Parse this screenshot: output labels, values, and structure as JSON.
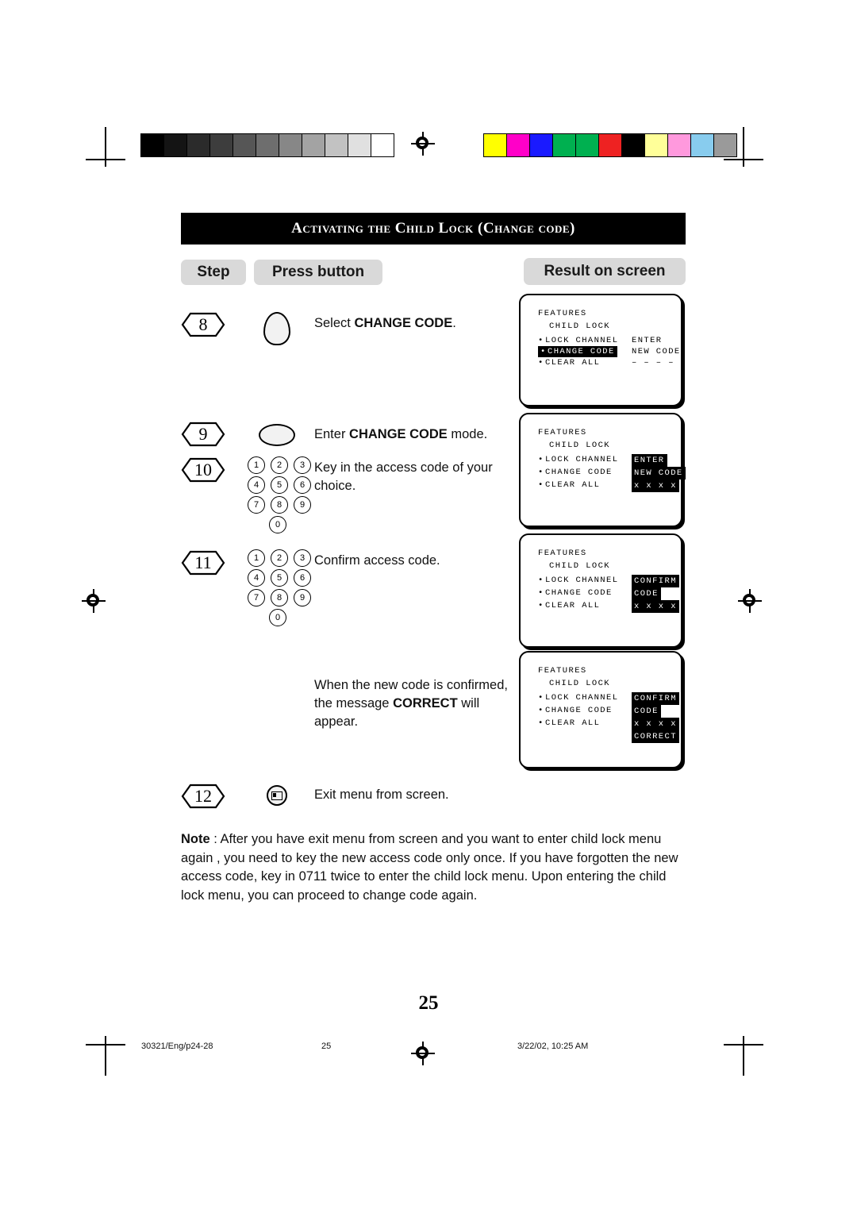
{
  "document": {
    "title": "Activating the Child Lock (Change code)",
    "page_number": "25",
    "footer": {
      "left": "30321/Eng/p24-28",
      "center": "25",
      "right": "3/22/02, 10:25 AM"
    }
  },
  "columns": {
    "step": "Step",
    "press_button": "Press button",
    "result": "Result on screen"
  },
  "steps": [
    {
      "number": "8",
      "control": "oval-button",
      "instruction_html": "Select <b>CHANGE CODE</b>.",
      "screen": {
        "header": "FEATURES",
        "sub": "CHILD LOCK",
        "rows": [
          {
            "label": "LOCK CHANNEL",
            "value": "ENTER",
            "label_inverted": false,
            "value_inverted": false
          },
          {
            "label": "CHANGE CODE",
            "value": "NEW CODE",
            "label_inverted": true,
            "value_inverted": false
          },
          {
            "label": "CLEAR ALL",
            "value": "– – – –",
            "label_inverted": false,
            "value_inverted": false
          }
        ]
      }
    },
    {
      "number": "9",
      "control": "flat-oval-button",
      "instruction_html": "Enter <b>CHANGE CODE</b> mode.",
      "screen": {
        "header": "FEATURES",
        "sub": "CHILD LOCK",
        "rows": [
          {
            "label": "LOCK CHANNEL",
            "value": "ENTER",
            "label_inverted": false,
            "value_inverted": true
          },
          {
            "label": "CHANGE CODE",
            "value": "NEW CODE",
            "label_inverted": false,
            "value_inverted": true
          },
          {
            "label": "CLEAR ALL",
            "value": "x x x x",
            "label_inverted": false,
            "value_inverted": true
          }
        ]
      }
    },
    {
      "number": "10",
      "control": "keypad",
      "instruction_html": "Key in the access code of your choice.",
      "screen": null
    },
    {
      "number": "11",
      "control": "keypad",
      "instruction_html": "Confirm access code.",
      "screen": {
        "header": "FEATURES",
        "sub": "CHILD LOCK",
        "rows": [
          {
            "label": "LOCK CHANNEL",
            "value": "CONFIRM",
            "label_inverted": false,
            "value_inverted": true
          },
          {
            "label": "CHANGE CODE",
            "value": "CODE",
            "label_inverted": false,
            "value_inverted": true
          },
          {
            "label": "CLEAR ALL",
            "value": "x x x x",
            "label_inverted": false,
            "value_inverted": true
          }
        ]
      }
    },
    {
      "number": "",
      "control": "none",
      "instruction_html": "When the new code is confirmed, the message <b>CORRECT</b> will appear.",
      "screen": {
        "header": "FEATURES",
        "sub": "CHILD LOCK",
        "rows": [
          {
            "label": "LOCK CHANNEL",
            "value": "CONFIRM",
            "label_inverted": false,
            "value_inverted": true
          },
          {
            "label": "CHANGE CODE",
            "value": "CODE",
            "label_inverted": false,
            "value_inverted": true
          },
          {
            "label": "CLEAR ALL",
            "value": "x x x x",
            "label_inverted": false,
            "value_inverted": true
          },
          {
            "label": "",
            "value": "CORRECT",
            "label_inverted": false,
            "value_inverted": true
          }
        ]
      }
    },
    {
      "number": "12",
      "control": "menu-icon",
      "instruction_html": "Exit menu from screen.",
      "screen": null
    }
  ],
  "keypad": {
    "keys": [
      "1",
      "2",
      "3",
      "4",
      "5",
      "6",
      "7",
      "8",
      "9",
      "0"
    ]
  },
  "note": {
    "label": "Note",
    "text_html": "<b>Note</b> :  After you have exit menu from screen and  you want to enter child lock menu again , you need to key the new access code only once. If you have forgotten the new access code, key in 0711 twice to enter the child lock menu. Upon entering the child lock menu, you can proceed to change code again."
  },
  "print_marks": {
    "greyscale_swatches": [
      "#000000",
      "#1a1a1a",
      "#333333",
      "#4d4d4d",
      "#666666",
      "#808080",
      "#999999",
      "#b3b3b3",
      "#cccccc",
      "#e6e6e6",
      "#ffffff"
    ],
    "color_swatches": [
      "#ffff00",
      "#ff00ff",
      "#0000ff",
      "#00a550",
      "#00a550",
      "#ed1c24",
      "#000000",
      "#ffff99",
      "#ff99cc",
      "#99ccff",
      "#999999"
    ]
  }
}
